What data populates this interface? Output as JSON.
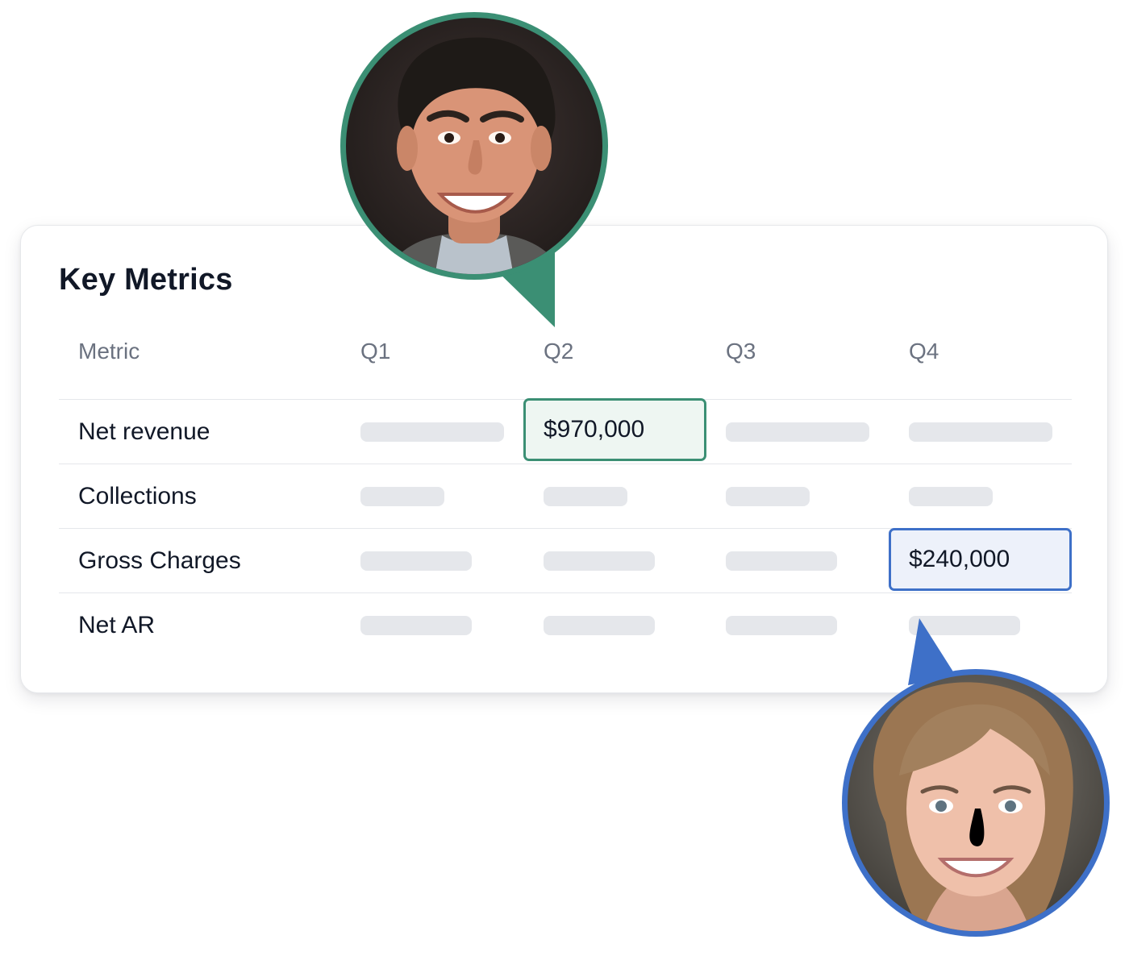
{
  "card": {
    "title": "Key Metrics"
  },
  "table": {
    "columns": [
      "Metric",
      "Q1",
      "Q2",
      "Q3",
      "Q4"
    ],
    "rows": [
      {
        "metric": "Net revenue",
        "q1": "",
        "q2": "$970,000",
        "q3": "",
        "q4": ""
      },
      {
        "metric": "Collections",
        "q1": "",
        "q2": "",
        "q3": "",
        "q4": ""
      },
      {
        "metric": "Gross Charges",
        "q1": "",
        "q2": "",
        "q3": "",
        "q4": "$240,000"
      },
      {
        "metric": "Net AR",
        "q1": "",
        "q2": "",
        "q3": "",
        "q4": ""
      }
    ]
  },
  "colors": {
    "green_accent": "#3b8f74",
    "blue_accent": "#3e70c8",
    "skeleton": "#e5e7eb"
  },
  "avatars": [
    {
      "icon": "male-avatar-icon",
      "ring_color": "#3b8f74"
    },
    {
      "icon": "female-avatar-icon",
      "ring_color": "#3e70c8"
    }
  ]
}
